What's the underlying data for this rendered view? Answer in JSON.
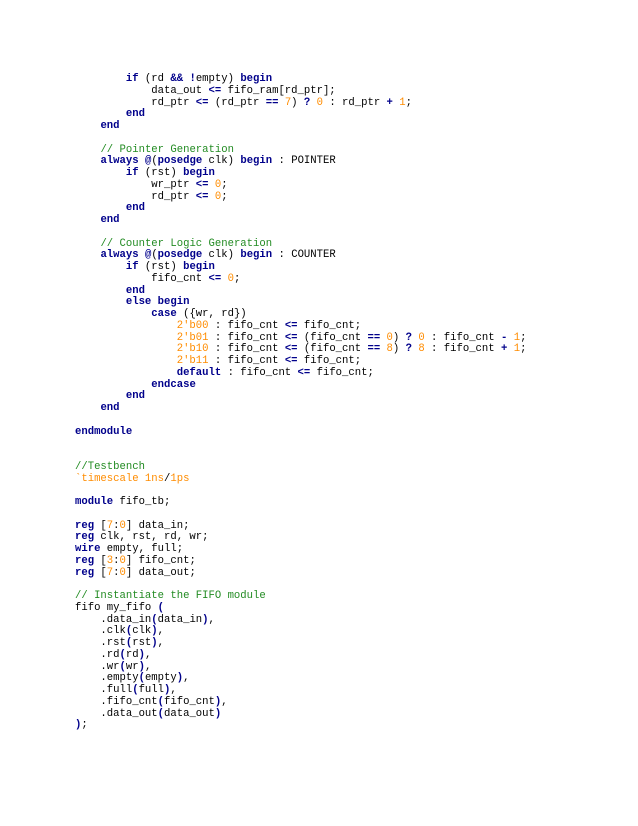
{
  "colors": {
    "keyword": "#00008b",
    "number": "#ff8c00",
    "comment": "#228b22",
    "operator": "#00008b",
    "plain": "#000000"
  },
  "lines": [
    [
      [
        "pl",
        "        "
      ],
      [
        "kw",
        "if"
      ],
      [
        "pl",
        " ("
      ],
      [
        "pl",
        "rd "
      ],
      [
        "op",
        "&&"
      ],
      [
        "pl",
        " "
      ],
      [
        "op",
        "!"
      ],
      [
        "pl",
        "empty) "
      ],
      [
        "kw",
        "begin"
      ]
    ],
    [
      [
        "pl",
        "            data_out "
      ],
      [
        "op",
        "<="
      ],
      [
        "pl",
        " fifo_ram[rd_ptr];"
      ]
    ],
    [
      [
        "pl",
        "            rd_ptr "
      ],
      [
        "op",
        "<="
      ],
      [
        "pl",
        " (rd_ptr "
      ],
      [
        "op",
        "=="
      ],
      [
        "pl",
        " "
      ],
      [
        "num",
        "7"
      ],
      [
        "pl",
        ") "
      ],
      [
        "op",
        "?"
      ],
      [
        "pl",
        " "
      ],
      [
        "num",
        "0"
      ],
      [
        "pl",
        " : rd_ptr "
      ],
      [
        "op",
        "+"
      ],
      [
        "pl",
        " "
      ],
      [
        "num",
        "1"
      ],
      [
        "pl",
        ";"
      ]
    ],
    [
      [
        "pl",
        "        "
      ],
      [
        "kw",
        "end"
      ]
    ],
    [
      [
        "pl",
        "    "
      ],
      [
        "kw",
        "end"
      ]
    ],
    [
      [
        "pl",
        ""
      ]
    ],
    [
      [
        "pl",
        "    "
      ],
      [
        "cm",
        "// Pointer Generation"
      ]
    ],
    [
      [
        "pl",
        "    "
      ],
      [
        "kw",
        "always"
      ],
      [
        "pl",
        " "
      ],
      [
        "op",
        "@"
      ],
      [
        "pl",
        "("
      ],
      [
        "kw",
        "posedge"
      ],
      [
        "pl",
        " clk) "
      ],
      [
        "kw",
        "begin"
      ],
      [
        "pl",
        " : POINTER"
      ]
    ],
    [
      [
        "pl",
        "        "
      ],
      [
        "kw",
        "if"
      ],
      [
        "pl",
        " (rst) "
      ],
      [
        "kw",
        "begin"
      ]
    ],
    [
      [
        "pl",
        "            wr_ptr "
      ],
      [
        "op",
        "<="
      ],
      [
        "pl",
        " "
      ],
      [
        "num",
        "0"
      ],
      [
        "pl",
        ";"
      ]
    ],
    [
      [
        "pl",
        "            rd_ptr "
      ],
      [
        "op",
        "<="
      ],
      [
        "pl",
        " "
      ],
      [
        "num",
        "0"
      ],
      [
        "pl",
        ";"
      ]
    ],
    [
      [
        "pl",
        "        "
      ],
      [
        "kw",
        "end"
      ]
    ],
    [
      [
        "pl",
        "    "
      ],
      [
        "kw",
        "end"
      ]
    ],
    [
      [
        "pl",
        ""
      ]
    ],
    [
      [
        "pl",
        "    "
      ],
      [
        "cm",
        "// Counter Logic Generation"
      ]
    ],
    [
      [
        "pl",
        "    "
      ],
      [
        "kw",
        "always"
      ],
      [
        "pl",
        " "
      ],
      [
        "op",
        "@"
      ],
      [
        "pl",
        "("
      ],
      [
        "kw",
        "posedge"
      ],
      [
        "pl",
        " clk) "
      ],
      [
        "kw",
        "begin"
      ],
      [
        "pl",
        " : COUNTER"
      ]
    ],
    [
      [
        "pl",
        "        "
      ],
      [
        "kw",
        "if"
      ],
      [
        "pl",
        " (rst) "
      ],
      [
        "kw",
        "begin"
      ]
    ],
    [
      [
        "pl",
        "            fifo_cnt "
      ],
      [
        "op",
        "<="
      ],
      [
        "pl",
        " "
      ],
      [
        "num",
        "0"
      ],
      [
        "pl",
        ";"
      ]
    ],
    [
      [
        "pl",
        "        "
      ],
      [
        "kw",
        "end"
      ]
    ],
    [
      [
        "pl",
        "        "
      ],
      [
        "kw",
        "else"
      ],
      [
        "pl",
        " "
      ],
      [
        "kw",
        "begin"
      ]
    ],
    [
      [
        "pl",
        "            "
      ],
      [
        "kw",
        "case"
      ],
      [
        "pl",
        " ({wr, rd})"
      ]
    ],
    [
      [
        "pl",
        "                "
      ],
      [
        "num",
        "2'b00"
      ],
      [
        "pl",
        " : fifo_cnt "
      ],
      [
        "op",
        "<="
      ],
      [
        "pl",
        " fifo_cnt;"
      ]
    ],
    [
      [
        "pl",
        "                "
      ],
      [
        "num",
        "2'b01"
      ],
      [
        "pl",
        " : fifo_cnt "
      ],
      [
        "op",
        "<="
      ],
      [
        "pl",
        " (fifo_cnt "
      ],
      [
        "op",
        "=="
      ],
      [
        "pl",
        " "
      ],
      [
        "num",
        "0"
      ],
      [
        "pl",
        ") "
      ],
      [
        "op",
        "?"
      ],
      [
        "pl",
        " "
      ],
      [
        "num",
        "0"
      ],
      [
        "pl",
        " : fifo_cnt "
      ],
      [
        "op",
        "-"
      ],
      [
        "pl",
        " "
      ],
      [
        "num",
        "1"
      ],
      [
        "pl",
        ";"
      ]
    ],
    [
      [
        "pl",
        "                "
      ],
      [
        "num",
        "2'b10"
      ],
      [
        "pl",
        " : fifo_cnt "
      ],
      [
        "op",
        "<="
      ],
      [
        "pl",
        " (fifo_cnt "
      ],
      [
        "op",
        "=="
      ],
      [
        "pl",
        " "
      ],
      [
        "num",
        "8"
      ],
      [
        "pl",
        ") "
      ],
      [
        "op",
        "?"
      ],
      [
        "pl",
        " "
      ],
      [
        "num",
        "8"
      ],
      [
        "pl",
        " : fifo_cnt "
      ],
      [
        "op",
        "+"
      ],
      [
        "pl",
        " "
      ],
      [
        "num",
        "1"
      ],
      [
        "pl",
        ";"
      ]
    ],
    [
      [
        "pl",
        "                "
      ],
      [
        "num",
        "2'b11"
      ],
      [
        "pl",
        " : fifo_cnt "
      ],
      [
        "op",
        "<="
      ],
      [
        "pl",
        " fifo_cnt;"
      ]
    ],
    [
      [
        "pl",
        "                "
      ],
      [
        "kw",
        "default"
      ],
      [
        "pl",
        " : fifo_cnt "
      ],
      [
        "op",
        "<="
      ],
      [
        "pl",
        " fifo_cnt;"
      ]
    ],
    [
      [
        "pl",
        "            "
      ],
      [
        "kw",
        "endcase"
      ]
    ],
    [
      [
        "pl",
        "        "
      ],
      [
        "kw",
        "end"
      ]
    ],
    [
      [
        "pl",
        "    "
      ],
      [
        "kw",
        "end"
      ]
    ],
    [
      [
        "pl",
        ""
      ]
    ],
    [
      [
        "kw",
        "endmodule"
      ]
    ],
    [
      [
        "pl",
        ""
      ]
    ],
    [
      [
        "pl",
        ""
      ]
    ],
    [
      [
        "cm",
        "//Testbench"
      ]
    ],
    [
      [
        "num",
        "`timescale 1ns"
      ],
      [
        "pl",
        "/"
      ],
      [
        "num",
        "1ps"
      ]
    ],
    [
      [
        "pl",
        ""
      ]
    ],
    [
      [
        "kw",
        "module"
      ],
      [
        "pl",
        " fifo_tb;"
      ]
    ],
    [
      [
        "pl",
        ""
      ]
    ],
    [
      [
        "kw",
        "reg"
      ],
      [
        "pl",
        " ["
      ],
      [
        "num",
        "7"
      ],
      [
        "pl",
        ":"
      ],
      [
        "num",
        "0"
      ],
      [
        "pl",
        "] data_in;"
      ]
    ],
    [
      [
        "kw",
        "reg"
      ],
      [
        "pl",
        " clk, rst, rd, wr;"
      ]
    ],
    [
      [
        "kw",
        "wire"
      ],
      [
        "pl",
        " empty, full;"
      ]
    ],
    [
      [
        "kw",
        "reg"
      ],
      [
        "pl",
        " ["
      ],
      [
        "num",
        "3"
      ],
      [
        "pl",
        ":"
      ],
      [
        "num",
        "0"
      ],
      [
        "pl",
        "] fifo_cnt;"
      ]
    ],
    [
      [
        "kw",
        "reg"
      ],
      [
        "pl",
        " ["
      ],
      [
        "num",
        "7"
      ],
      [
        "pl",
        ":"
      ],
      [
        "num",
        "0"
      ],
      [
        "pl",
        "] data_out;"
      ]
    ],
    [
      [
        "pl",
        ""
      ]
    ],
    [
      [
        "cm",
        "// Instantiate the FIFO module"
      ]
    ],
    [
      [
        "pl",
        "fifo my_fifo "
      ],
      [
        "op",
        "("
      ]
    ],
    [
      [
        "pl",
        "    .data_in"
      ],
      [
        "op",
        "("
      ],
      [
        "pl",
        "data_in"
      ],
      [
        "op",
        ")"
      ],
      [
        "pl",
        ","
      ]
    ],
    [
      [
        "pl",
        "    .clk"
      ],
      [
        "op",
        "("
      ],
      [
        "pl",
        "clk"
      ],
      [
        "op",
        ")"
      ],
      [
        "pl",
        ","
      ]
    ],
    [
      [
        "pl",
        "    .rst"
      ],
      [
        "op",
        "("
      ],
      [
        "pl",
        "rst"
      ],
      [
        "op",
        ")"
      ],
      [
        "pl",
        ","
      ]
    ],
    [
      [
        "pl",
        "    .rd"
      ],
      [
        "op",
        "("
      ],
      [
        "pl",
        "rd"
      ],
      [
        "op",
        ")"
      ],
      [
        "pl",
        ","
      ]
    ],
    [
      [
        "pl",
        "    .wr"
      ],
      [
        "op",
        "("
      ],
      [
        "pl",
        "wr"
      ],
      [
        "op",
        ")"
      ],
      [
        "pl",
        ","
      ]
    ],
    [
      [
        "pl",
        "    .empty"
      ],
      [
        "op",
        "("
      ],
      [
        "pl",
        "empty"
      ],
      [
        "op",
        ")"
      ],
      [
        "pl",
        ","
      ]
    ],
    [
      [
        "pl",
        "    .full"
      ],
      [
        "op",
        "("
      ],
      [
        "pl",
        "full"
      ],
      [
        "op",
        ")"
      ],
      [
        "pl",
        ","
      ]
    ],
    [
      [
        "pl",
        "    .fifo_cnt"
      ],
      [
        "op",
        "("
      ],
      [
        "pl",
        "fifo_cnt"
      ],
      [
        "op",
        ")"
      ],
      [
        "pl",
        ","
      ]
    ],
    [
      [
        "pl",
        "    .data_out"
      ],
      [
        "op",
        "("
      ],
      [
        "pl",
        "data_out"
      ],
      [
        "op",
        ")"
      ]
    ],
    [
      [
        "op",
        ")"
      ],
      [
        "pl",
        ";"
      ]
    ]
  ]
}
